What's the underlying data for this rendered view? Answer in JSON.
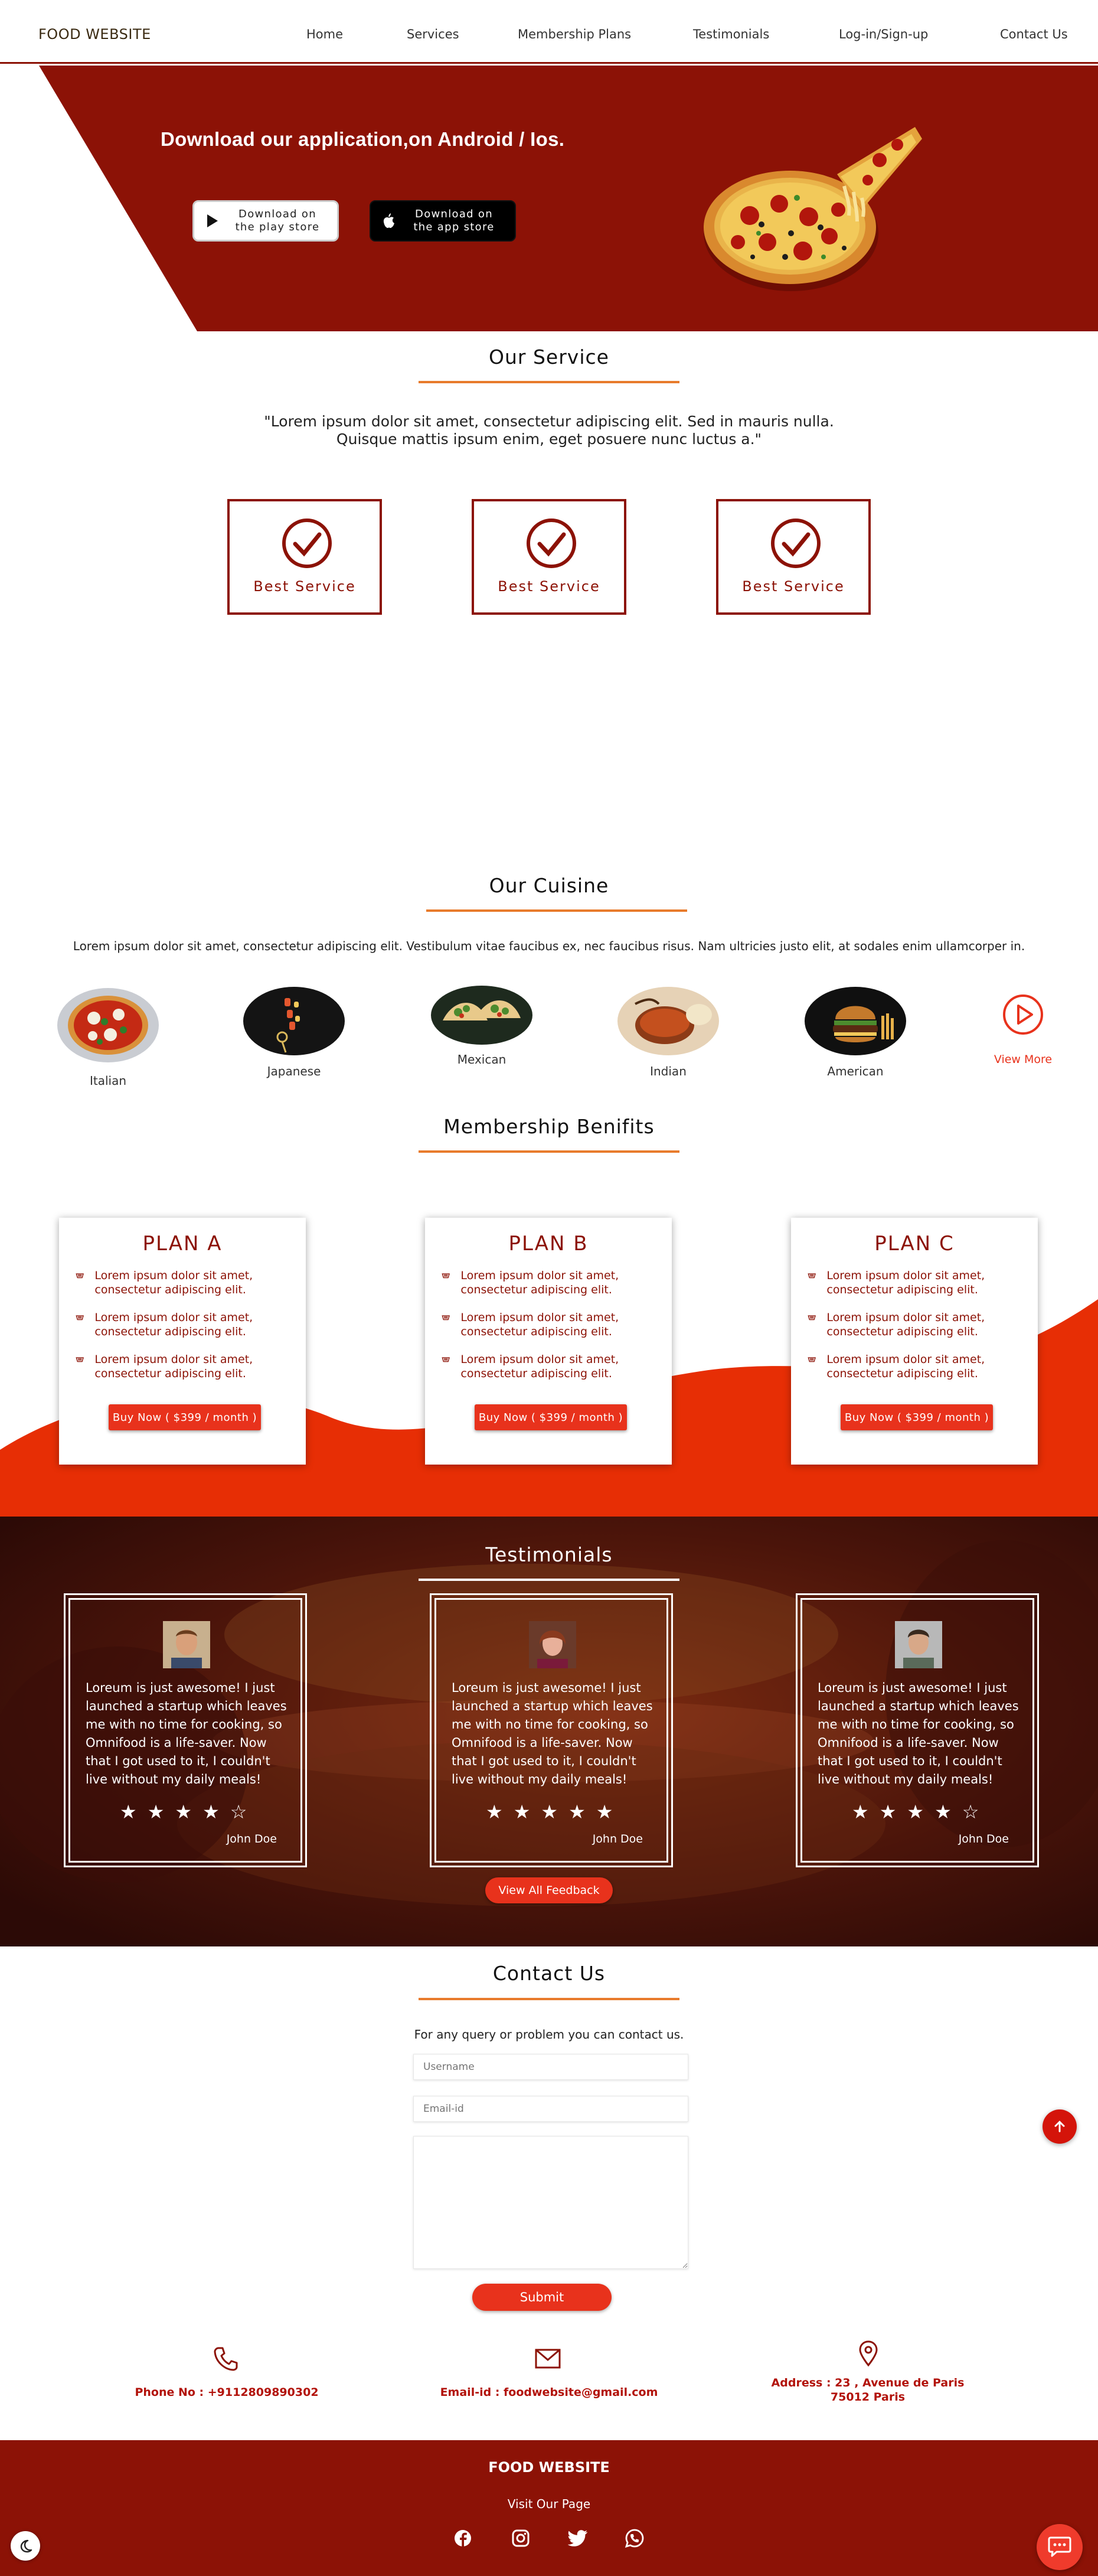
{
  "nav": {
    "brand": "FOOD WEBSITE",
    "links": [
      "Home",
      "Services",
      "Membership Plans",
      "Testimonials",
      "Log-in/Sign-up",
      "Contact Us"
    ]
  },
  "hero": {
    "title": "Download our application,on Android / Ios.",
    "play_store": "Download on the play store",
    "app_store": "Download on the app store",
    "colors": {
      "banner": "#8c1206"
    }
  },
  "services": {
    "title": "Our Service",
    "quote_line1": "\"Lorem ipsum dolor sit amet, consectetur adipiscing elit. Sed in mauris nulla.",
    "quote_line2": "Quisque mattis ipsum enim, eget posuere nunc luctus a.\"",
    "items": [
      "Best Service",
      "Best Service",
      "Best Service"
    ]
  },
  "cuisine": {
    "title": "Our Cuisine",
    "description": "Lorem ipsum dolor sit amet, consectetur adipiscing elit. Vestibulum vitae faucibus ex, nec faucibus risus. Nam ultricies justo elit, at sodales enim ullamcorper in.",
    "items": [
      "Italian",
      "Japanese",
      "Mexican",
      "Indian",
      "American"
    ],
    "view_more": "View More"
  },
  "membership": {
    "title": "Membership Benifits",
    "plans": [
      {
        "name": "PLAN A",
        "items": [
          "Lorem ipsum dolor sit amet, consectetur adipiscing elit.",
          "Lorem ipsum dolor sit amet, consectetur adipiscing elit.",
          "Lorem ipsum dolor sit amet, consectetur adipiscing elit."
        ],
        "button": "Buy Now ( $399 / month )"
      },
      {
        "name": "PLAN B",
        "items": [
          "Lorem ipsum dolor sit amet, consectetur adipiscing elit.",
          "Lorem ipsum dolor sit amet, consectetur adipiscing elit.",
          "Lorem ipsum dolor sit amet, consectetur adipiscing elit."
        ],
        "button": "Buy Now ( $399 / month )"
      },
      {
        "name": "PLAN C",
        "items": [
          "Lorem ipsum dolor sit amet, consectetur adipiscing elit.",
          "Lorem ipsum dolor sit amet, consectetur adipiscing elit.",
          "Lorem ipsum dolor sit amet, consectetur adipiscing elit."
        ],
        "button": "Buy Now ( $399 / month )"
      }
    ]
  },
  "testimonials": {
    "title": "Testimonials",
    "cards": [
      {
        "text": "Loreum is just awesome! I just launched a startup which leaves me with no time for cooking, so Omnifood is a life-saver. Now that I got used to it, I couldn't live without my daily meals!",
        "stars": "★★★★☆",
        "rating": 4,
        "name": "John Doe"
      },
      {
        "text": "Loreum is just awesome! I just launched a startup which leaves me with no time for cooking, so Omnifood is a life-saver. Now that I got used to it, I couldn't live without my daily meals!",
        "stars": "★★★★★",
        "rating": 5,
        "name": "John Doe"
      },
      {
        "text": "Loreum is just awesome! I just launched a startup which leaves me with no time for cooking, so Omnifood is a life-saver. Now that I got used to it, I couldn't live without my daily meals!",
        "stars": "★★★★☆",
        "rating": 4,
        "name": "John Doe"
      }
    ],
    "view_all": "View All Feedback"
  },
  "contact": {
    "title": "Contact Us",
    "subtitle": "For any query or problem you can contact us.",
    "username_placeholder": "Username",
    "email_placeholder": "Email-id",
    "submit": "Submit",
    "phone": "Phone No : +9112809890302",
    "email": "Email-id : foodwebsite@gmail.com",
    "address_line1": "Address : 23 , Avenue de Paris",
    "address_line2": "75012 Paris"
  },
  "footer": {
    "brand": "FOOD WEBSITE",
    "visit": "Visit Our Page",
    "social_icons": [
      "facebook-icon",
      "instagram-icon",
      "twitter-icon",
      "whatsapp-icon"
    ]
  },
  "colors": {
    "primary": "#8c1206",
    "accent": "#e8321c",
    "line": "#e87b2c"
  }
}
